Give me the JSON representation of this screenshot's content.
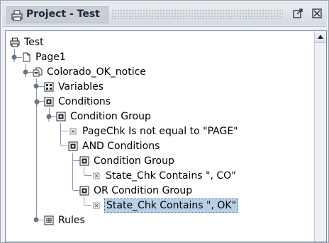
{
  "window": {
    "title": "Project - Test",
    "icons": {
      "title_icon": "printer-icon",
      "undock": "undock-icon",
      "close": "close-icon"
    }
  },
  "tree": {
    "nodes": [
      {
        "label": "Test",
        "icon": "printer-icon"
      },
      {
        "label": "Page1",
        "icon": "page-icon"
      },
      {
        "label": "Colorado_OK_notice",
        "icon": "pages-icon"
      },
      {
        "label": "Variables",
        "icon": "variables-icon"
      },
      {
        "label": "Conditions",
        "icon": "conditions-icon"
      },
      {
        "label": "Condition Group",
        "icon": "condition-group-icon"
      },
      {
        "label": "PageChk Is not equal to \"PAGE\"",
        "icon": "condition-item-icon"
      },
      {
        "label": "AND Conditions",
        "icon": "condition-group-icon"
      },
      {
        "label": "Condition Group",
        "icon": "condition-group-icon"
      },
      {
        "label": "State_Chk Contains \", CO\"",
        "icon": "condition-item-icon"
      },
      {
        "label": "OR Condition Group",
        "icon": "condition-group-icon"
      },
      {
        "label": "State_Chk Contains \", OK\"",
        "icon": "condition-item-icon",
        "selected": true
      },
      {
        "label": "Rules",
        "icon": "rules-icon"
      }
    ]
  },
  "colors": {
    "selection": "#b8cfe5",
    "titlebar": "#d6dbe1",
    "tree_lines": "#8c96a3"
  }
}
